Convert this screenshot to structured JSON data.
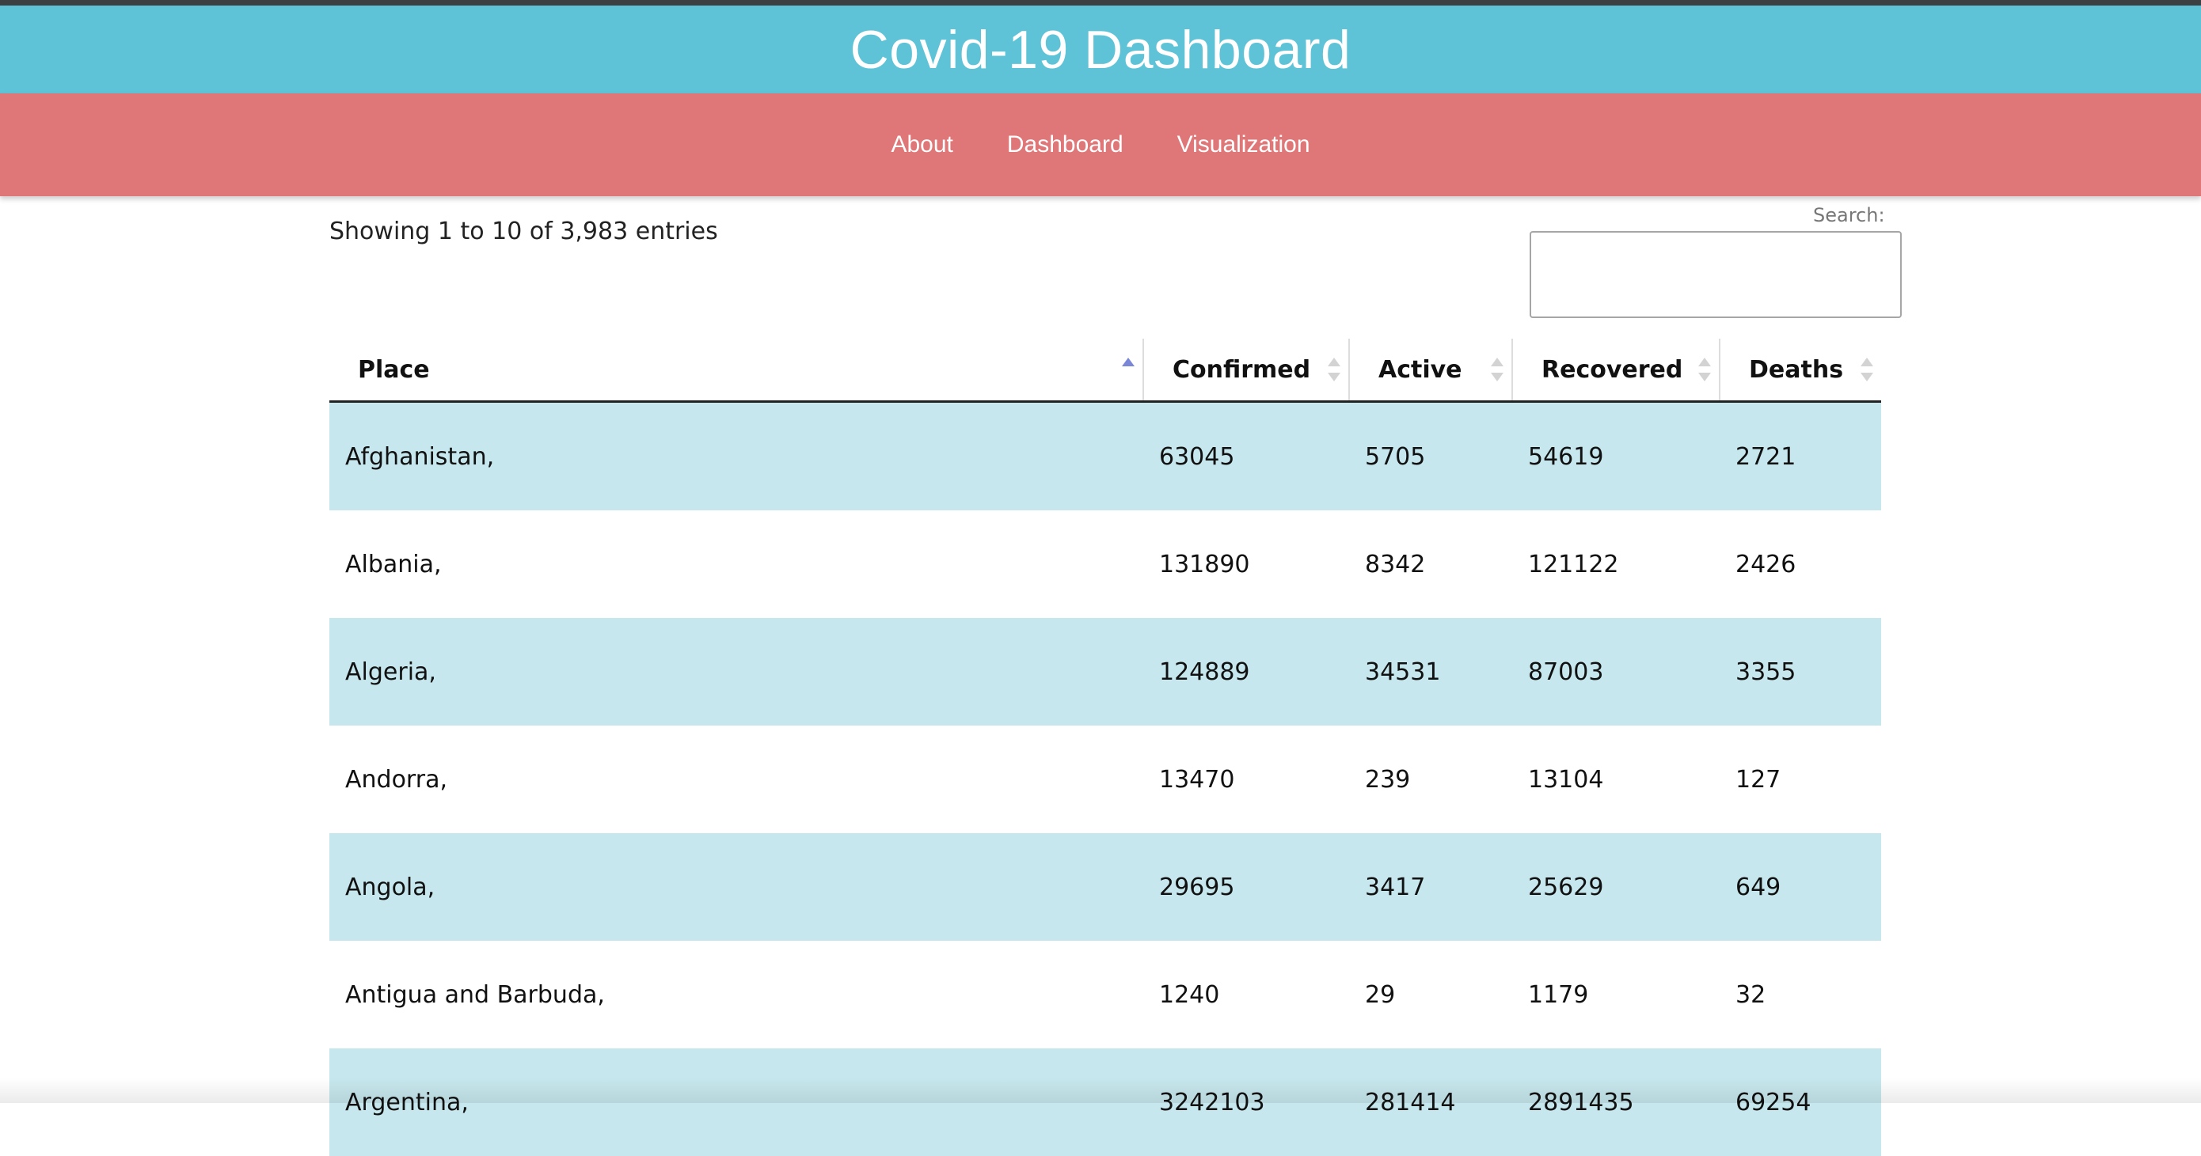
{
  "header": {
    "title": "Covid-19 Dashboard"
  },
  "nav": {
    "items": [
      "About",
      "Dashboard",
      "Visualization"
    ]
  },
  "table_info": "Showing 1 to 10 of 3,983 entries",
  "search": {
    "label": "Search:",
    "value": ""
  },
  "table": {
    "columns": [
      "Place",
      "Confirmed",
      "Active",
      "Recovered",
      "Deaths"
    ],
    "sorted_column": "Place",
    "sort_direction": "ascending",
    "rows": [
      [
        "Afghanistan,",
        "63045",
        "5705",
        "54619",
        "2721"
      ],
      [
        "Albania,",
        "131890",
        "8342",
        "121122",
        "2426"
      ],
      [
        "Algeria,",
        "124889",
        "34531",
        "87003",
        "3355"
      ],
      [
        "Andorra,",
        "13470",
        "239",
        "13104",
        "127"
      ],
      [
        "Angola,",
        "29695",
        "3417",
        "25629",
        "649"
      ],
      [
        "Antigua and Barbuda,",
        "1240",
        "29",
        "1179",
        "32"
      ],
      [
        "Argentina,",
        "3242103",
        "281414",
        "2891435",
        "69254"
      ]
    ]
  },
  "colors": {
    "title_bar": "#5ec3d6",
    "nav_bar": "#df7677",
    "row_stripe": "#c6e7ed",
    "sort_active": "#7a86d6"
  }
}
